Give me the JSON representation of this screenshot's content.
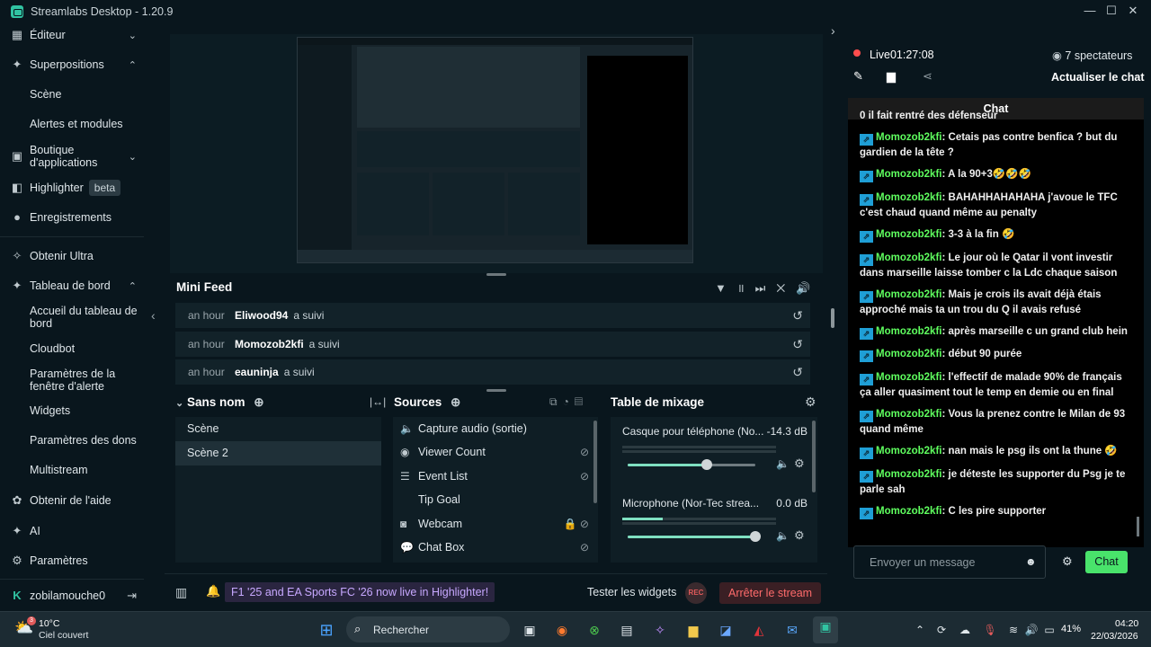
{
  "window": {
    "title": "Streamlabs Desktop - 1.20.9"
  },
  "sidebar": {
    "items": [
      {
        "label": "Éditeur",
        "icon": "editor-icon"
      },
      {
        "label": "Superpositions",
        "icon": "overlays-icon"
      },
      {
        "label": "Scène"
      },
      {
        "label": "Alertes et modules"
      },
      {
        "label": "Boutique d'applications",
        "icon": "store-icon"
      },
      {
        "label": "Highlighter",
        "icon": "highlighter-icon",
        "badge": "beta"
      },
      {
        "label": "Enregistrements",
        "icon": "recordings-icon"
      },
      {
        "label": "Obtenir Ultra",
        "icon": "ultra-icon"
      },
      {
        "label": "Tableau de bord",
        "icon": "dashboard-icon"
      },
      {
        "label": "Accueil du tableau de bord"
      },
      {
        "label": "Cloudbot"
      },
      {
        "label": "Paramètres de la fenêtre d'alerte"
      },
      {
        "label": "Widgets"
      },
      {
        "label": "Paramètres des dons"
      },
      {
        "label": "Multistream"
      },
      {
        "label": "Obtenir de l'aide",
        "icon": "help-icon"
      },
      {
        "label": "AI",
        "icon": "ai-icon"
      },
      {
        "label": "Paramètres",
        "icon": "settings-icon"
      }
    ],
    "user": "zobilamouche0"
  },
  "minifeed": {
    "title": "Mini Feed",
    "rows": [
      {
        "time": "an hour",
        "name": "Eliwood94",
        "action": "a suivi"
      },
      {
        "time": "an hour",
        "name": "Momozob2kfi",
        "action": "a suivi"
      },
      {
        "time": "an hour",
        "name": "eauninja",
        "action": "a suivi"
      }
    ]
  },
  "scenes": {
    "title": "Sans nom",
    "items": [
      "Scène",
      "Scène 2"
    ]
  },
  "sources": {
    "title": "Sources",
    "items": [
      "Capture audio (sortie)",
      "Viewer Count",
      "Event List",
      "Tip Goal",
      "Webcam",
      "Chat Box"
    ]
  },
  "mixer": {
    "title": "Table de mixage",
    "channels": [
      {
        "name": "Casque pour téléphone (No...",
        "value": "-14.3 dB",
        "level": 0.62
      },
      {
        "name": "Microphone (Nor-Tec strea...",
        "value": "0.0 dB",
        "level": 1.0
      }
    ]
  },
  "bottombar": {
    "promo": "F1 '25 and EA Sports FC '26 now live in Highlighter!",
    "test_widgets": "Tester les widgets",
    "rec": "REC",
    "stop": "Arrêter le stream"
  },
  "live": {
    "status": "Live",
    "time": "01:27:08",
    "viewers": "7 spectateurs",
    "refresh": "Actualiser le chat"
  },
  "chat": {
    "title": "Chat",
    "messages": [
      {
        "user": "",
        "text": "0 il fait rentré des défenseur"
      },
      {
        "user": "Momozob2kfi",
        "text": "Cetais pas contre benfica ? but du gardien de la tête ?"
      },
      {
        "user": "Momozob2kfi",
        "text": "A la 90+3🤣🤣🤣"
      },
      {
        "user": "Momozob2kfi",
        "text": "BAHAHHAHAHAHA j'avoue le TFC c'est chaud quand même au penalty"
      },
      {
        "user": "Momozob2kfi",
        "text": "3-3 à la fin 🤣"
      },
      {
        "user": "Momozob2kfi",
        "text": "Le jour où le Qatar il vont investir dans marseille laisse tomber c la Ldc chaque saison"
      },
      {
        "user": "Momozob2kfi",
        "text": "Mais je crois ils avait déjà étais approché mais ta un trou du Q il avais refusé"
      },
      {
        "user": "Momozob2kfi",
        "text": "après marseille c un grand club hein"
      },
      {
        "user": "Momozob2kfi",
        "text": "début 90 purée"
      },
      {
        "user": "Momozob2kfi",
        "text": "l'effectif de malade 90% de français ça aller quasiment tout le temp en demie ou en final"
      },
      {
        "user": "Momozob2kfi",
        "text": "Vous la prenez contre le Milan de 93 quand même"
      },
      {
        "user": "Momozob2kfi",
        "text": "nan mais le psg ils ont la thune 🤣"
      },
      {
        "user": "Momozob2kfi",
        "text": "je déteste les supporter du Psg je te parle sah"
      },
      {
        "user": "Momozob2kfi",
        "text": "C les pire supporter"
      }
    ],
    "input_placeholder": "Envoyer un message",
    "send": "Chat"
  },
  "taskbar": {
    "temp": "10°C",
    "weather": "Ciel couvert",
    "weather_badge": "3",
    "search": "Rechercher",
    "battery": "41%",
    "time": "04:20",
    "date": "22/03/2026"
  },
  "colors": {
    "accent": "#31c3a2",
    "live": "#ff4d4d",
    "chat_user": "#5fff5f",
    "send": "#49e36b"
  }
}
